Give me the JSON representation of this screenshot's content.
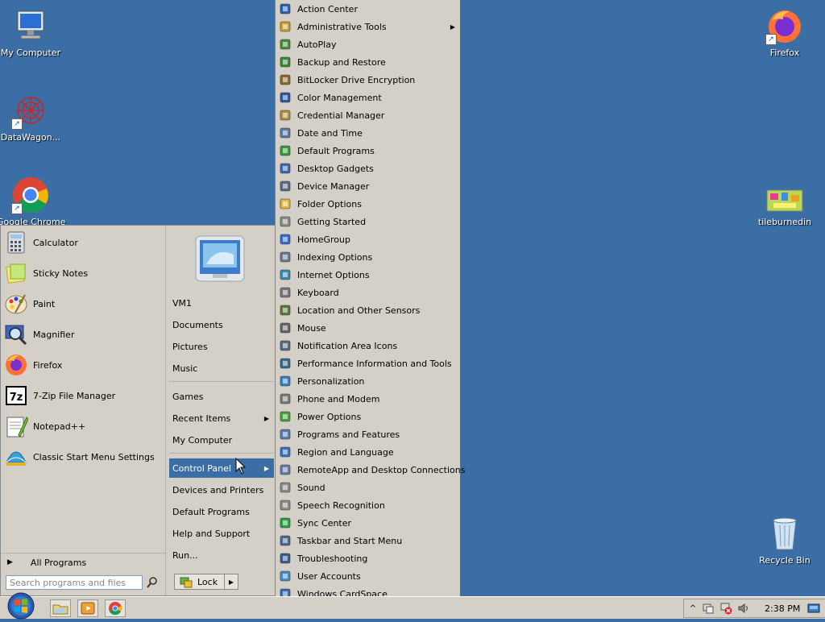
{
  "desktop": {
    "icons": [
      {
        "name": "desktop-icon-my-computer",
        "label": "My Computer"
      },
      {
        "name": "desktop-icon-datawagon",
        "label": "DataWagon..."
      },
      {
        "name": "desktop-icon-google-chrome",
        "label": "Google Chrome"
      },
      {
        "name": "desktop-icon-firefox",
        "label": "Firefox"
      },
      {
        "name": "desktop-icon-tileburnedin",
        "label": "tileburnedin"
      },
      {
        "name": "desktop-icon-recycle-bin",
        "label": "Recycle Bin"
      }
    ]
  },
  "start_menu": {
    "programs": [
      "Calculator",
      "Sticky Notes",
      "Paint",
      "Magnifier",
      "Firefox",
      "7-Zip File Manager",
      "Notepad++",
      "Classic Start Menu Settings"
    ],
    "all_programs": "All Programs",
    "search_placeholder": "Search programs and files",
    "right_items": [
      "VM1",
      "Documents",
      "Pictures",
      "Music",
      "Games",
      "Recent Items",
      "My Computer",
      "Control Panel",
      "Devices and Printers",
      "Default Programs",
      "Help and Support",
      "Run..."
    ],
    "lock_label": "Lock"
  },
  "control_panel_menu": {
    "items": [
      "Action Center",
      "Administrative Tools",
      "AutoPlay",
      "Backup and Restore",
      "BitLocker Drive Encryption",
      "Color Management",
      "Credential Manager",
      "Date and Time",
      "Default Programs",
      "Desktop Gadgets",
      "Device Manager",
      "Folder Options",
      "Getting Started",
      "HomeGroup",
      "Indexing Options",
      "Internet Options",
      "Keyboard",
      "Location and Other Sensors",
      "Mouse",
      "Notification Area Icons",
      "Performance Information and Tools",
      "Personalization",
      "Phone and Modem",
      "Power Options",
      "Programs and Features",
      "Region and Language",
      "RemoteApp and Desktop Connections",
      "Sound",
      "Speech Recognition",
      "Sync Center",
      "Taskbar and Start Menu",
      "Troubleshooting",
      "User Accounts",
      "Windows CardSpace"
    ]
  },
  "taskbar": {
    "clock": "2:38 PM"
  },
  "colors": {
    "desktop": "#3b6ea5",
    "menu_bg": "#d4d0c8",
    "highlight": "#3b6ea5"
  }
}
